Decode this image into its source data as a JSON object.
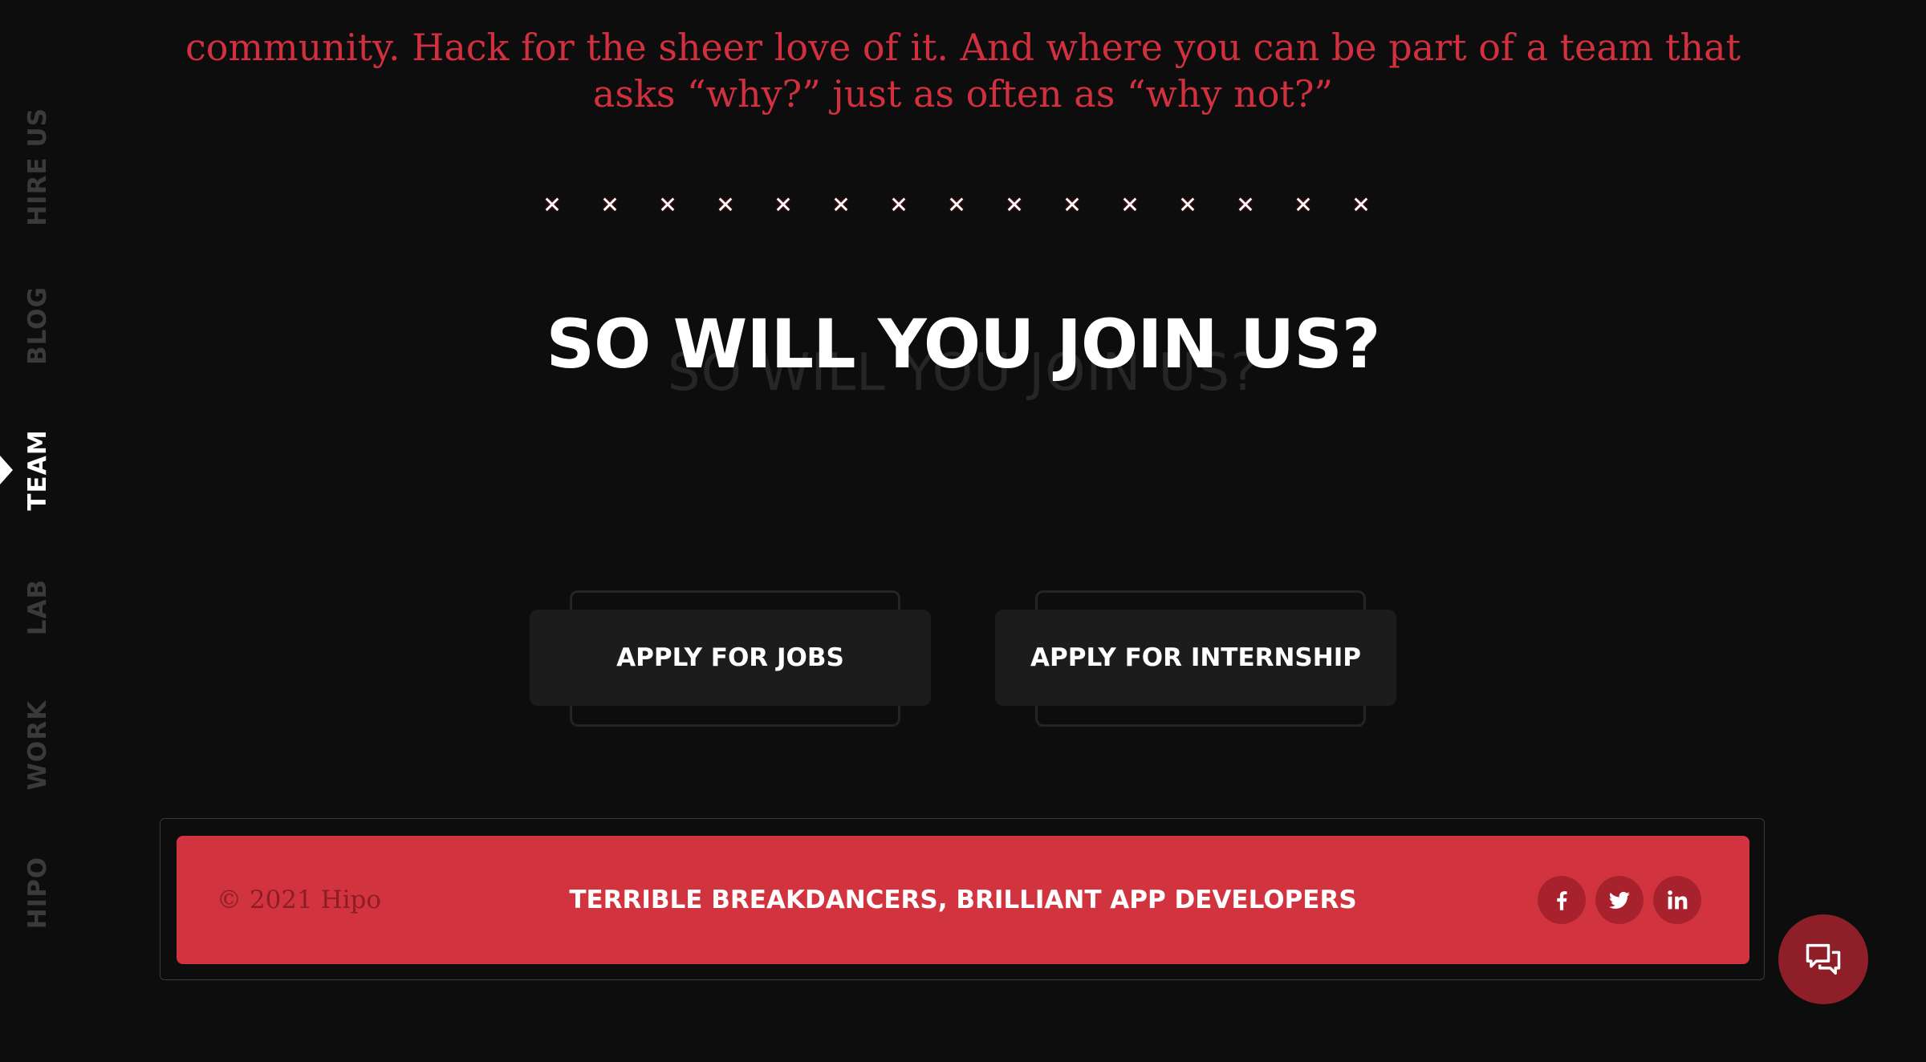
{
  "sidenav": {
    "items": [
      {
        "label": "HIRE US",
        "active": false
      },
      {
        "label": "BLOG",
        "active": false
      },
      {
        "label": "TEAM",
        "active": true
      },
      {
        "label": "LAB",
        "active": false
      },
      {
        "label": "WORK",
        "active": false
      },
      {
        "label": "HIPO",
        "active": false
      }
    ]
  },
  "intro": {
    "line1": "community. Hack for the sheer love of it. And where you can be part of a team that",
    "line2": "asks “why?” just as often as “why not?”"
  },
  "divider": {
    "glyph": "✕",
    "count": 15
  },
  "heading": {
    "main": "SO WILL YOU JOIN US?",
    "ghost": "SO WILL YOU JOIN US?"
  },
  "buttons": {
    "jobs_label": "APPLY FOR JOBS",
    "internship_label": "APPLY FOR INTERNSHIP"
  },
  "footer": {
    "copyright": "© 2021 Hipo",
    "tagline": "TERRIBLE BREAKDANCERS, BRILLIANT APP DEVELOPERS",
    "social": [
      "facebook-icon",
      "twitter-icon",
      "linkedin-icon"
    ]
  },
  "colors": {
    "accent": "#d2343f",
    "background": "#0d0d0d",
    "button_bg": "#1c1c1c",
    "social_bg": "#a8222d",
    "chat_bg": "#8e1f29"
  },
  "icons": {
    "chat": "chat-icon"
  }
}
